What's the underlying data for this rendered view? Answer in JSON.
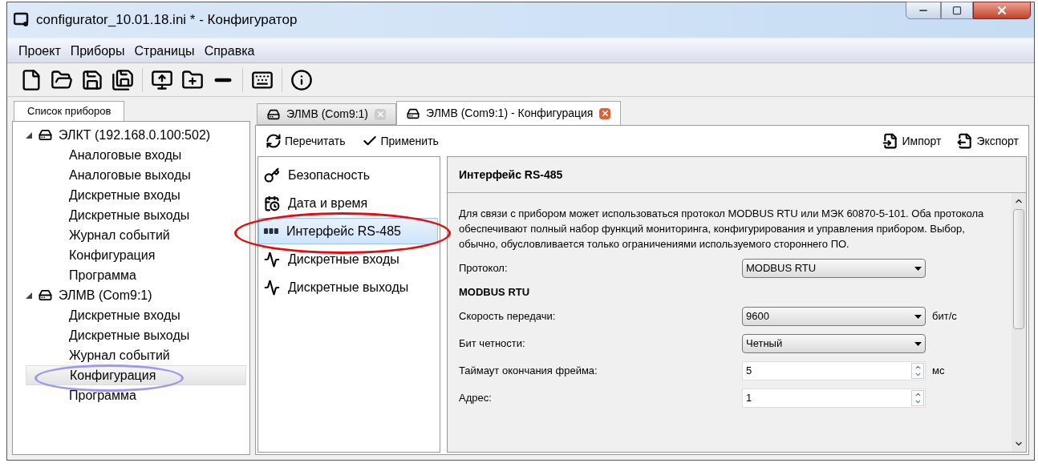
{
  "window": {
    "title": "configurator_10.01.18.ini * - Конфигуратор"
  },
  "menu": [
    "Проект",
    "Приборы",
    "Страницы",
    "Справка"
  ],
  "device_panel": {
    "tab": "Список приборов",
    "devices": [
      {
        "label": "ЭЛКТ (192.168.0.100:502)",
        "expanded": true,
        "children": [
          {
            "label": "Аналоговые входы",
            "selected": false
          },
          {
            "label": "Аналоговые выходы",
            "selected": false
          },
          {
            "label": "Дискретные входы",
            "selected": false
          },
          {
            "label": "Дискретные выходы",
            "selected": false
          },
          {
            "label": "Журнал событий",
            "selected": false
          },
          {
            "label": "Конфигурация",
            "selected": false
          },
          {
            "label": "Программа",
            "selected": false
          }
        ]
      },
      {
        "label": "ЭЛМВ (Com9:1)",
        "expanded": true,
        "children": [
          {
            "label": "Дискретные входы",
            "selected": false
          },
          {
            "label": "Дискретные выходы",
            "selected": false
          },
          {
            "label": "Журнал событий",
            "selected": false
          },
          {
            "label": "Конфигурация",
            "selected": true
          },
          {
            "label": "Программа",
            "selected": false
          }
        ]
      }
    ]
  },
  "doc_tabs": [
    {
      "label": "ЭЛМВ (Com9:1)",
      "selected": false
    },
    {
      "label": "ЭЛМВ (Com9:1) - Конфигурация",
      "selected": true
    }
  ],
  "actions": {
    "left": [
      {
        "kind": "reload",
        "label": "Перечитать"
      },
      {
        "kind": "apply",
        "label": "Применить"
      }
    ],
    "right": [
      {
        "kind": "import",
        "label": "Импорт"
      },
      {
        "kind": "export",
        "label": "Экспорт"
      }
    ]
  },
  "nav": [
    {
      "kind": "key",
      "label": "Безопасность",
      "selected": false
    },
    {
      "kind": "calendar",
      "label": "Дата и время",
      "selected": false
    },
    {
      "kind": "port",
      "label": "Интерфейс RS-485",
      "selected": true
    },
    {
      "kind": "input",
      "label": "Дискретные входы",
      "selected": false
    },
    {
      "kind": "output",
      "label": "Дискретные выходы",
      "selected": false
    }
  ],
  "config": {
    "title": "Интерфейс RS-485",
    "description": "Для связи с прибором может использоваться протокол MODBUS RTU или МЭК 60870-5-101. Оба протокола обеспечивают полный набор функций мониторинга, конфигурирования и управления прибором. Выбор, обычно, обусловливается только ограничениями используемого стороннего ПО.",
    "fields": [
      {
        "kind": "select",
        "label": "Протокол:",
        "value": "MODBUS RTU"
      },
      {
        "kind": "heading",
        "label": "MODBUS RTU"
      },
      {
        "kind": "select",
        "label": "Скорость передачи:",
        "value": "9600",
        "unit": "бит/с"
      },
      {
        "kind": "select",
        "label": "Бит четности:",
        "value": "Четный"
      },
      {
        "kind": "spin",
        "label": "Таймаут окончания фрейма:",
        "value": "5",
        "unit": "мс"
      },
      {
        "kind": "spin",
        "label": "Адрес:",
        "value": "1"
      }
    ]
  }
}
